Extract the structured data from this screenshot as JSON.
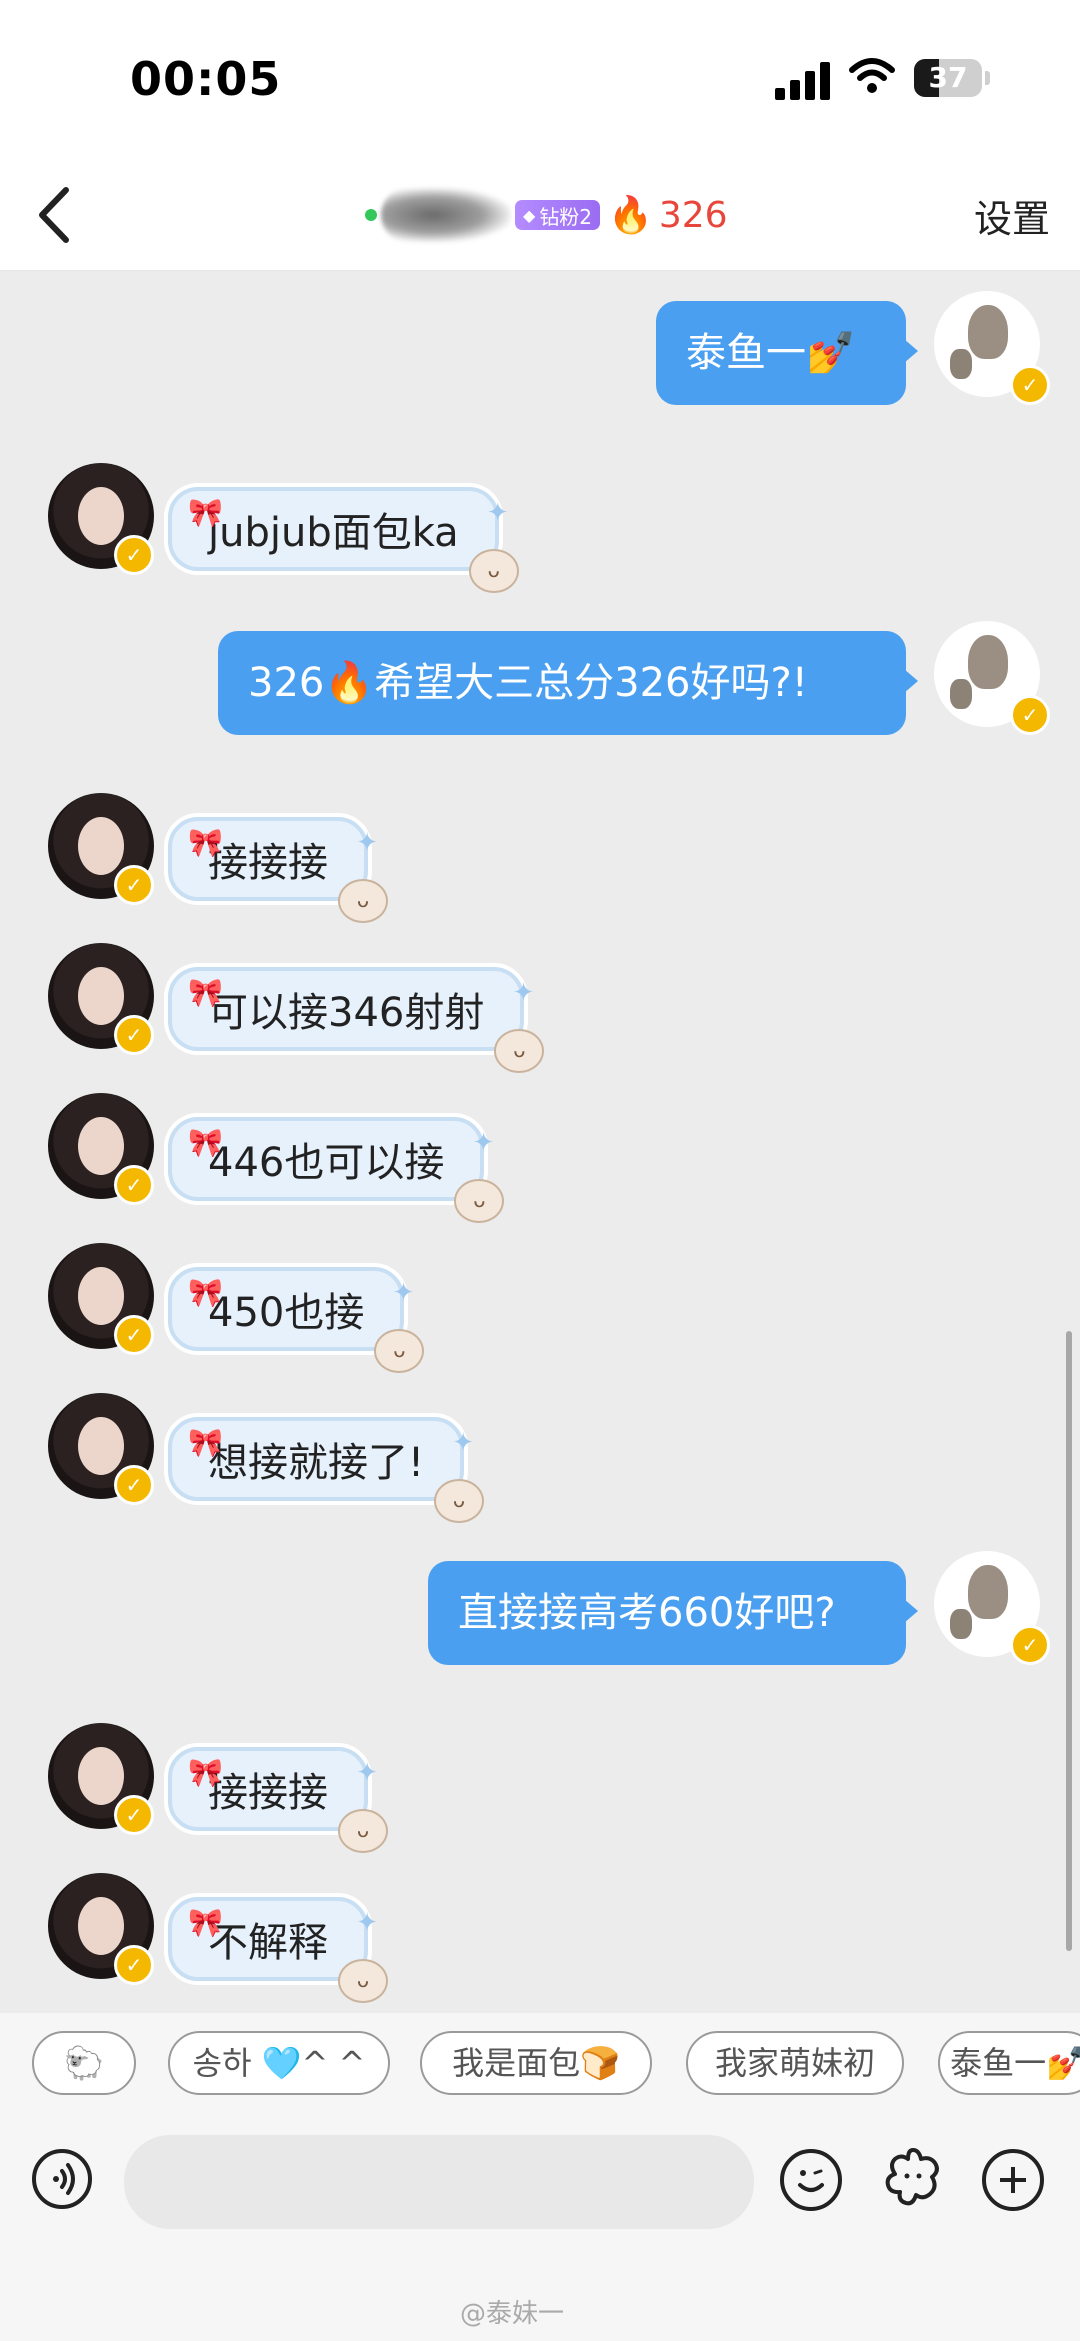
{
  "status_bar": {
    "time": "00:05",
    "battery": "37",
    "battery_level": 0.37
  },
  "header": {
    "back_icon": "chevron-left-icon",
    "fan_badge": "钻粉2",
    "streak": "326",
    "settings": "设置"
  },
  "messages": [
    {
      "side": "right",
      "text": "泰鱼一💅"
    },
    {
      "side": "left",
      "text": "jubjub面包ka"
    },
    {
      "side": "right",
      "text": "326🔥希望大三总分326好吗?!"
    },
    {
      "side": "left",
      "text": "接接接"
    },
    {
      "side": "left",
      "text": "可以接346射射"
    },
    {
      "side": "left",
      "text": "446也可以接"
    },
    {
      "side": "left",
      "text": "450也接"
    },
    {
      "side": "left",
      "text": "想接就接了!"
    },
    {
      "side": "right",
      "text": "直接接高考660好吧?"
    },
    {
      "side": "left",
      "text": "接接接"
    },
    {
      "side": "left",
      "text": "不解释"
    }
  ],
  "quick_replies": [
    "🐑",
    "송하 🩵^ ^",
    "我是面包🍞",
    "我家萌妹初",
    "泰鱼一💅"
  ],
  "input": {
    "placeholder": ""
  },
  "watermark": "@泰妹一",
  "colors": {
    "bubble_self": "#4a9ff0",
    "bubble_other": "#e6f1fc",
    "chat_bg": "#ececec",
    "streak": "#e8463b",
    "verified": "#f5b800"
  }
}
